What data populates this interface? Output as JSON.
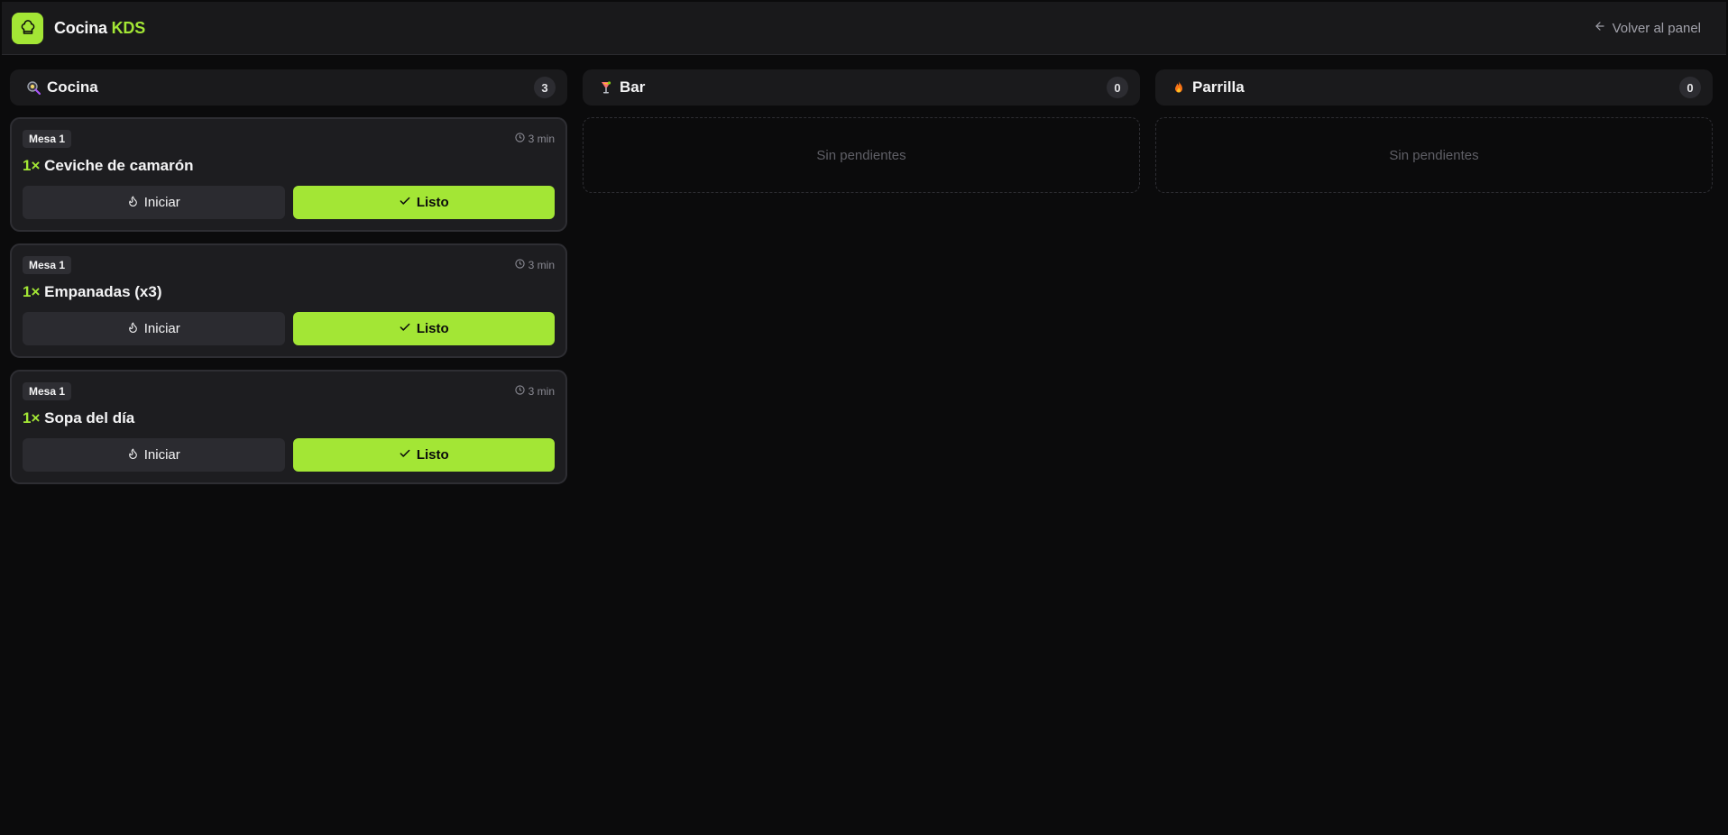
{
  "header": {
    "brand_main": "Cocina",
    "brand_accent": "KDS",
    "back_label": "Volver al panel"
  },
  "colors": {
    "accent": "#a3e635",
    "background": "#0b0b0c",
    "panel": "#1a1a1c"
  },
  "columns": [
    {
      "title": "Cocina",
      "icon": "frying-pan-icon",
      "count": "3",
      "tickets": [
        {
          "table": "Mesa 1",
          "time": "3 min",
          "qty": "1×",
          "item": "Ceviche de camarón",
          "start_label": "Iniciar",
          "done_label": "Listo"
        },
        {
          "table": "Mesa 1",
          "time": "3 min",
          "qty": "1×",
          "item": "Empanadas (x3)",
          "start_label": "Iniciar",
          "done_label": "Listo"
        },
        {
          "table": "Mesa 1",
          "time": "3 min",
          "qty": "1×",
          "item": "Sopa del día",
          "start_label": "Iniciar",
          "done_label": "Listo"
        }
      ]
    },
    {
      "title": "Bar",
      "icon": "cocktail-icon",
      "count": "0",
      "empty_text": "Sin pendientes"
    },
    {
      "title": "Parrilla",
      "icon": "fire-icon",
      "count": "0",
      "empty_text": "Sin pendientes"
    }
  ]
}
